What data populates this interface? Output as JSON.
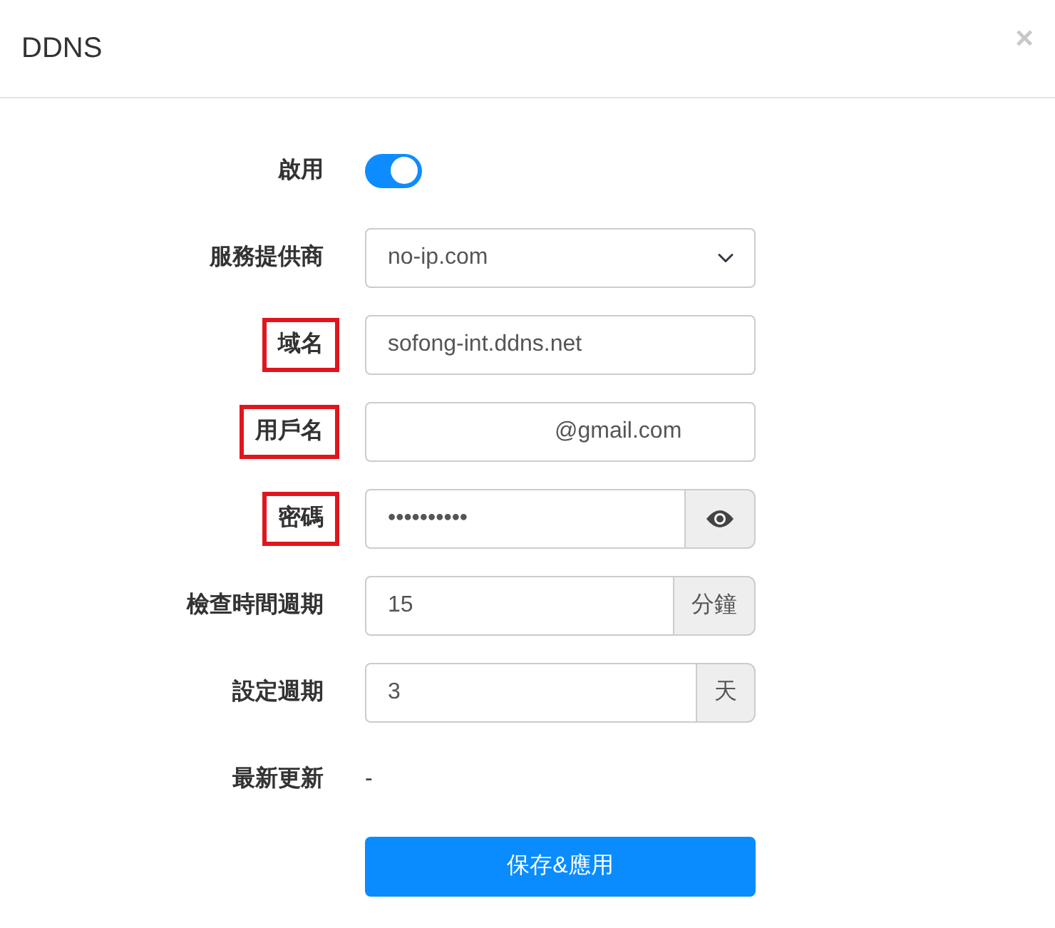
{
  "window": {
    "title": "DDNS",
    "close": "×"
  },
  "fields": [
    {
      "kind": "switch",
      "label": "啟用",
      "highlighted": false,
      "on": true
    },
    {
      "kind": "select",
      "label": "服務提供商",
      "highlighted": false,
      "value": "no-ip.com"
    },
    {
      "kind": "text",
      "label": "域名",
      "highlighted": true,
      "value": "sofong-int.ddns.net",
      "redacted_prefix": false
    },
    {
      "kind": "text",
      "label": "用戶名",
      "highlighted": true,
      "value": "@gmail.com",
      "redacted_prefix": true
    },
    {
      "kind": "password",
      "label": "密碼",
      "highlighted": true,
      "value": "••••••••••"
    },
    {
      "kind": "addon",
      "label": "檢查時間週期",
      "highlighted": false,
      "value": "15",
      "suffix": "分鐘"
    },
    {
      "kind": "addon",
      "label": "設定週期",
      "highlighted": false,
      "value": "3",
      "suffix": "天"
    },
    {
      "kind": "static",
      "label": "最新更新",
      "highlighted": false,
      "value": "-"
    }
  ],
  "buttons": [
    {
      "label": "保存&應用"
    }
  ]
}
